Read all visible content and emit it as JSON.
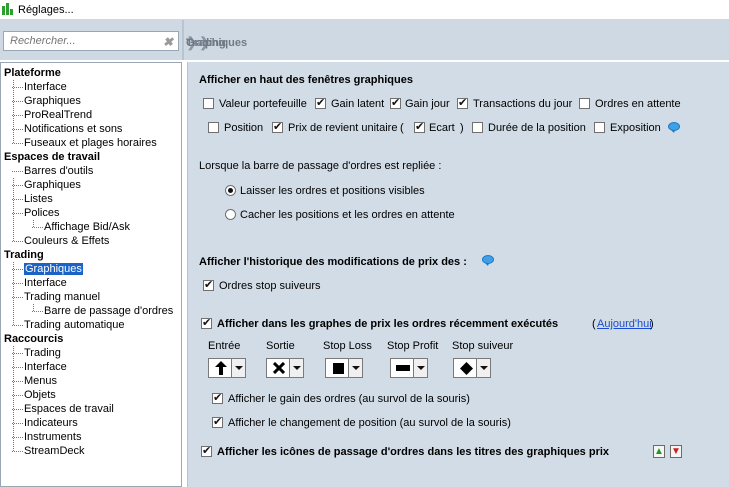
{
  "window": {
    "title": "Réglages..."
  },
  "search": {
    "placeholder": "Rechercher..."
  },
  "breadcrumb": {
    "items": [
      "Trading",
      "Graphiques"
    ]
  },
  "sidebar": {
    "groups": [
      {
        "label": "Plateforme",
        "items": [
          "Interface",
          "Graphiques",
          "ProRealTrend",
          "Notifications et sons",
          "Fuseaux et plages horaires"
        ]
      },
      {
        "label": "Espaces de travail",
        "items": [
          "Barres d'outils",
          "Graphiques",
          "Listes",
          "Polices",
          "Affichage Bid/Ask",
          "Couleurs & Effets"
        ]
      },
      {
        "label": "Trading",
        "items": [
          "Graphiques",
          "Interface",
          "Trading manuel",
          "Barre de passage d'ordres",
          "Trading automatique"
        ]
      },
      {
        "label": "Raccourcis",
        "items": [
          "Trading",
          "Interface",
          "Menus",
          "Objets",
          "Espaces de travail",
          "Indicateurs",
          "Instruments",
          "StreamDeck"
        ]
      }
    ],
    "selected": "Graphiques"
  },
  "section_top": {
    "title": "Afficher en haut des fenêtres graphiques",
    "options": [
      {
        "label": "Valeur portefeuille",
        "checked": false
      },
      {
        "label": "Gain latent",
        "checked": true
      },
      {
        "label": "Gain jour",
        "checked": true
      },
      {
        "label": "Transactions du jour",
        "checked": true
      },
      {
        "label": "Ordres en attente",
        "checked": false
      },
      {
        "label": "Position",
        "checked": false
      },
      {
        "label": "Prix de revient unitaire",
        "checked": true
      },
      {
        "label": "Ecart",
        "checked": true
      },
      {
        "label": "Durée de la position",
        "checked": false
      },
      {
        "label": "Exposition",
        "checked": false
      }
    ],
    "paren_open": "(",
    "paren_close": ")"
  },
  "section_folded": {
    "title": "Lorsque la barre de passage d'ordres est repliée :",
    "radios": [
      {
        "label": "Laisser les ordres et positions visibles",
        "selected": true
      },
      {
        "label": "Cacher les positions et les ordres en attente",
        "selected": false
      }
    ]
  },
  "section_history": {
    "title": "Afficher l'historique des modifications de prix des :",
    "option": {
      "label": "Ordres stop suiveurs",
      "checked": true
    }
  },
  "section_executed": {
    "label": "Afficher dans les graphes de prix les ordres récemment exécutés",
    "checked": true,
    "link": "Aujourd'hui",
    "link_paren_open": "(",
    "link_paren_close": ")",
    "columns": [
      {
        "label": "Entrée",
        "icon": "up-arrow-icon"
      },
      {
        "label": "Sortie",
        "icon": "cross-icon"
      },
      {
        "label": "Stop Loss",
        "icon": "square-icon"
      },
      {
        "label": "Stop Profit",
        "icon": "rectangle-icon"
      },
      {
        "label": "Stop suiveur",
        "icon": "diamond-icon"
      }
    ],
    "suboptions": [
      {
        "label": "Afficher le gain des ordres (au survol de la souris)",
        "checked": true
      },
      {
        "label": "Afficher le changement de position (au survol de la souris)",
        "checked": true
      }
    ]
  },
  "section_icons": {
    "label": "Afficher les icônes de passage d'ordres dans les titres des graphiques prix",
    "checked": true
  },
  "colors": {
    "panel_bg": "#d2dce6",
    "selection": "#1c63c7",
    "link": "#1a4bd1"
  }
}
